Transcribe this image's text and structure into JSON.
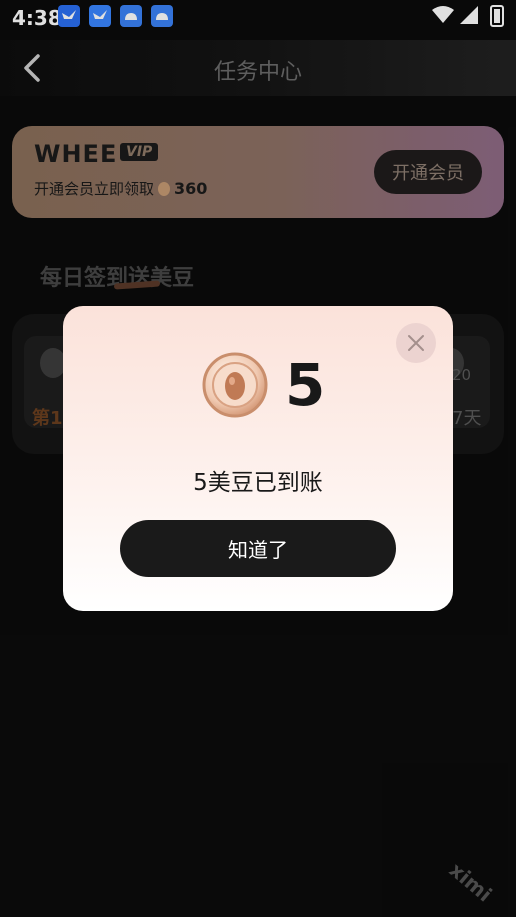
{
  "status_bar": {
    "time": "4:38",
    "notification_icons": [
      "bird-app-icon",
      "bird-app-icon",
      "cloud-app-icon",
      "cloud-app-icon"
    ],
    "right_icons": [
      "wifi-icon",
      "signal-icon",
      "battery-charging-icon"
    ]
  },
  "header": {
    "title": "任务中心",
    "back_icon": "chevron-left-icon"
  },
  "vip_card": {
    "logo": "WHEE",
    "badge": "VIP",
    "subtitle": "开通会员立即领取",
    "bean_count": "360",
    "button_label": "开通会员"
  },
  "daily": {
    "title": "每日签到送美豆",
    "left_day_label": "第1",
    "right_day_number": "20",
    "right_day_label": "7天"
  },
  "dialog": {
    "amount": "5",
    "message": "5美豆已到账",
    "confirm_label": "知道了",
    "close_icon": "close-icon",
    "coin_icon": "bean-coin-icon"
  },
  "watermark": "ximi",
  "colors": {
    "background": "#0b0b0b",
    "vip_gradient_start": "#8a6f5a",
    "vip_gradient_end": "#8f6a86",
    "dialog_top": "#fbe2da",
    "confirm_button": "#1a1a1a"
  }
}
